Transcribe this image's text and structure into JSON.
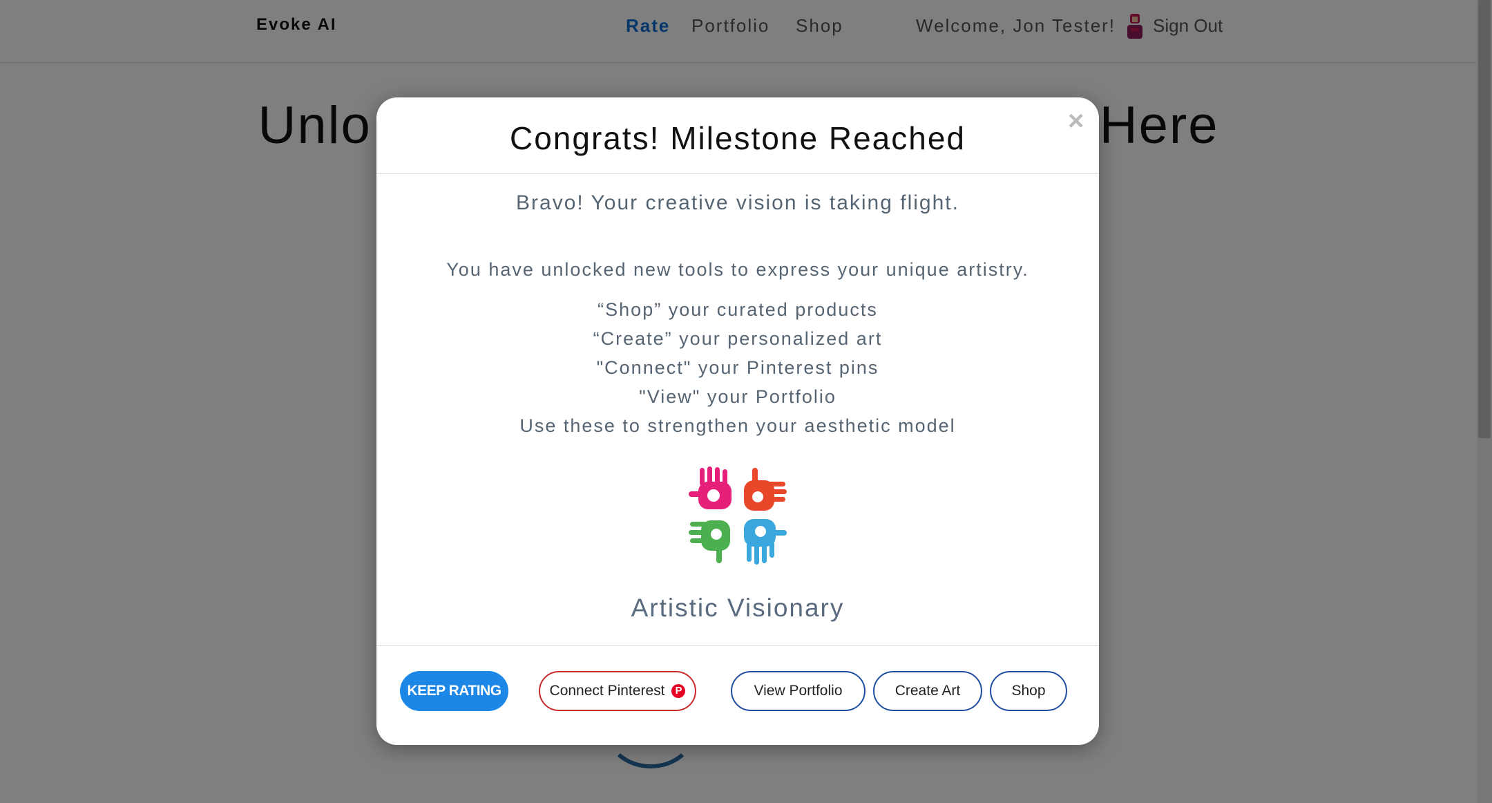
{
  "navbar": {
    "brand": "Evoke AI",
    "links": [
      {
        "label": "Rate",
        "active": true
      },
      {
        "label": "Portfolio",
        "active": false
      },
      {
        "label": "Shop",
        "active": false
      }
    ],
    "welcome": "Welcome, Jon Tester!",
    "sign_out": "Sign Out"
  },
  "hero": {
    "title_left": "Unlo",
    "title_right": "Here"
  },
  "modal": {
    "close": "×",
    "title": "Congrats! Milestone Reached",
    "lead": "Bravo! Your creative vision is taking flight.",
    "unlock_line": "You have unlocked new tools to express your unique artistry.",
    "features": [
      "“Shop” your curated products",
      "“Create” your personalized art",
      "\"Connect\" your Pinterest pins",
      "\"View\" your Portfolio",
      "Use these to strengthen your aesthetic model"
    ],
    "badge_title": "Artistic Visionary",
    "buttons": {
      "keep_rating": "KEEP RATING",
      "connect_pinterest": "Connect Pinterest",
      "view_portfolio": "View Portfolio",
      "create_art": "Create Art",
      "shop": "Shop"
    }
  },
  "colors": {
    "primary": "#1c87e6",
    "pinterest": "#e60023",
    "outline_blue": "#1f4ea0",
    "text_muted": "#566573",
    "hand_colors": [
      "#e6207a",
      "#e8472a",
      "#4caf50",
      "#3aa7df"
    ]
  },
  "icons": {
    "close": "close-icon",
    "pinterest": "pinterest-icon",
    "logo": "hands-logo-icon",
    "avatar": "avatar-icon"
  }
}
